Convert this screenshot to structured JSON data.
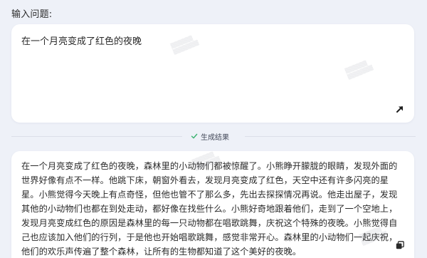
{
  "input_section": {
    "label": "输入问题:",
    "question": "在一个月亮变成了红色的夜晚"
  },
  "result_divider": {
    "label": "生成结果"
  },
  "output_section": {
    "answer": "在一个月亮变成了红色的夜晚，森林里的小动物们都被惊醒了。小熊睁开朦胧的眼睛，发现外面的世界好像有点不一样。他跳下床，朝窗外看去，发现月亮变成了红色，天空中还有许多闪亮的星星。小熊觉得今天晚上有点奇怪，但他也管不了那么多，先出去探探情况再说。他走出屋子，发现其他的小动物们也都在到处走动，都好像在找些什么。小熊好奇地跟着他们，走到了一个空地上，发现月亮变成红色的原因是森林里的每一只动物都在唱歌跳舞，庆祝这个特殊的夜晚。小熊觉得自己也应该加入他们的行列，于是他也开始唱歌跳舞，感觉非常开心。森林里的小动物们一起庆祝，他们的欢乐声传遍了整个森林，让所有的生物都知道了这个美好的夜晚。"
  },
  "icons": {
    "expand": "expand-arrow-icon",
    "check": "check-icon",
    "copy": "copy-icon"
  },
  "colors": {
    "background": "#eef1f8",
    "card": "#ffffff",
    "check_green": "#3cb371"
  }
}
